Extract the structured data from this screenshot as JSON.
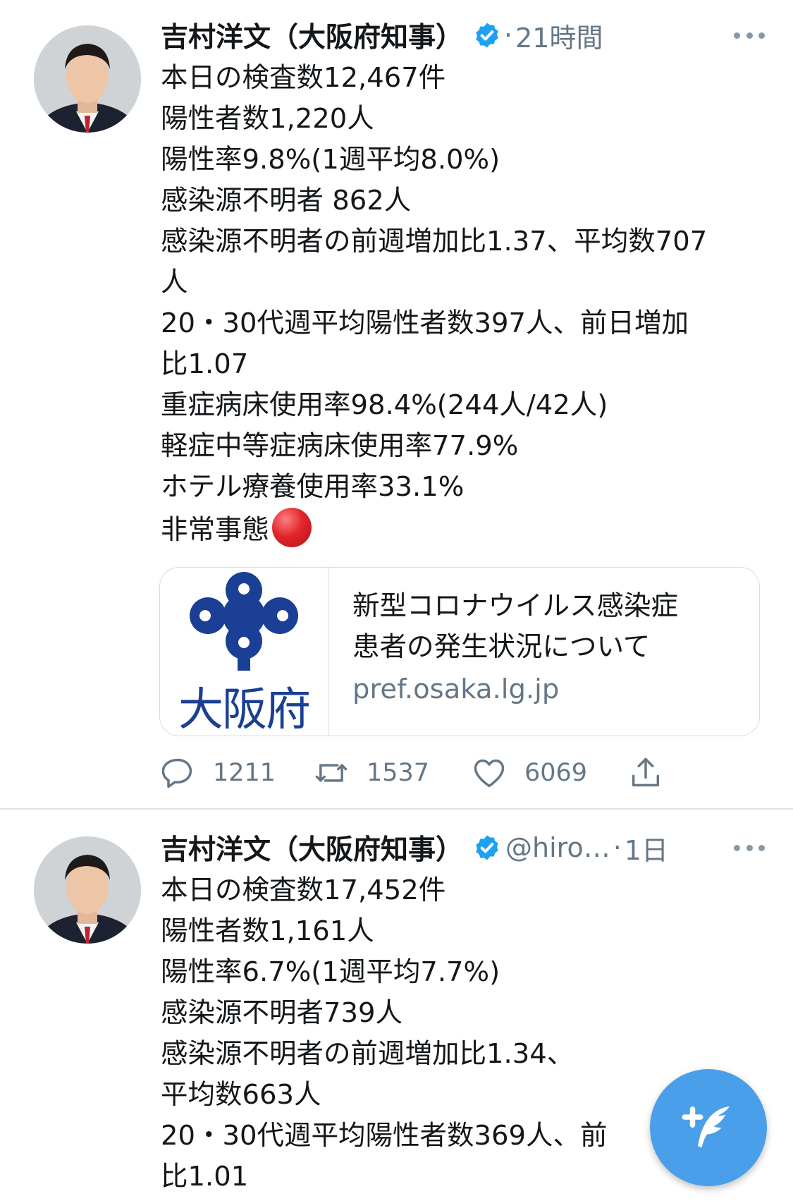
{
  "tweets": [
    {
      "author": "吉村洋文（大阪府知事）",
      "handle": "",
      "time": "21時間",
      "lines": [
        "本日の検査数12,467件",
        "陽性者数1,220人",
        "陽性率9.8%(1週平均8.0%)",
        "感染源不明者 862人",
        "感染源不明者の前週増加比1.37、平均数707",
        "人",
        "20・30代週平均陽性者数397人、前日増加",
        "比1.07",
        "重症病床使用率98.4%(244人/42人)",
        "軽症中等症病床使用率77.9%",
        "ホテル療養使用率33.1%",
        "非常事態"
      ],
      "status_emoji": "red-circle-icon",
      "card": {
        "logo_text": "大阪府",
        "title_line1": "新型コロナウイルス感染症",
        "title_line2": "患者の発生状況について",
        "domain": "pref.osaka.lg.jp"
      },
      "actions": {
        "replies": "1211",
        "retweets": "1537",
        "likes": "6069"
      }
    },
    {
      "author": "吉村洋文（大阪府知事）",
      "handle": "@hiro…",
      "time": "1日",
      "lines": [
        "本日の検査数17,452件",
        "陽性者数1,161人",
        "陽性率6.7%(1週平均7.7%)",
        "感染源不明者739人",
        "感染源不明者の前週増加比1.34、",
        "平均数663人",
        "20・30代週平均陽性者数369人、前",
        "比1.01"
      ]
    }
  ],
  "colors": {
    "accent": "#1da1f2",
    "fab": "#4a9fea",
    "secondary_text": "#657786",
    "osaka_blue": "#1a3f95"
  }
}
